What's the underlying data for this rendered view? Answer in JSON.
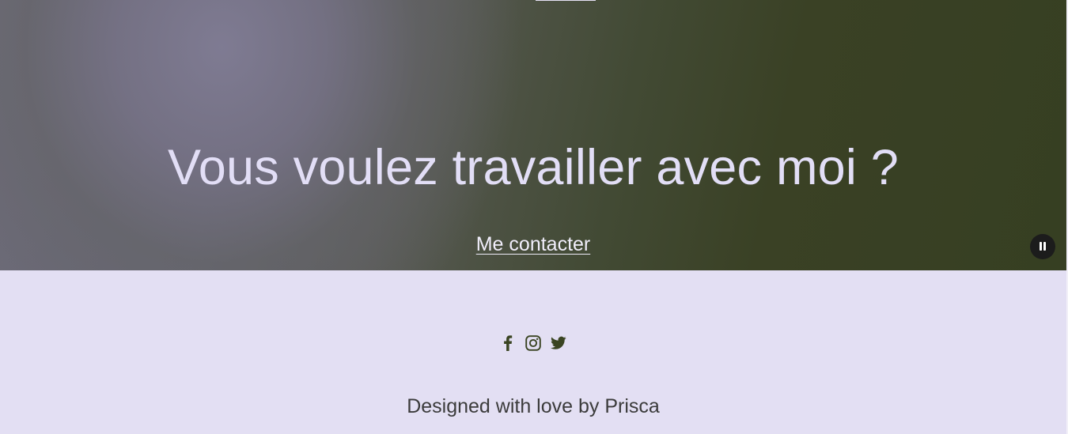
{
  "hero": {
    "title": "Vous voulez travailler avec moi ?",
    "cta_label": "Me contacter",
    "pause_icon": "pause-icon"
  },
  "footer": {
    "social": [
      {
        "name": "facebook",
        "icon": "facebook-icon"
      },
      {
        "name": "instagram",
        "icon": "instagram-icon"
      },
      {
        "name": "twitter",
        "icon": "twitter-icon"
      }
    ],
    "credit": "Designed with love by Prisca"
  },
  "colors": {
    "footer_bg": "#e3dff3",
    "hero_text": "#e2def6",
    "icon_color": "#3a4422",
    "credit_text": "#3b3b3b"
  }
}
